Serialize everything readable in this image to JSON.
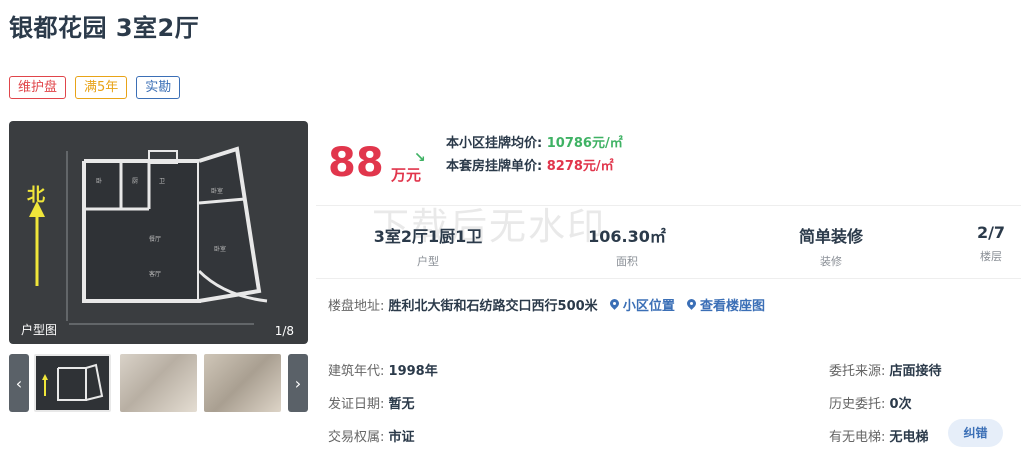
{
  "listing": {
    "title": "银都花园 3室2厅",
    "tags": [
      {
        "label": "维护盘",
        "color": "#e0454a"
      },
      {
        "label": "满5年",
        "color": "#e8a317"
      },
      {
        "label": "实勘",
        "color": "#3b6fb6"
      }
    ]
  },
  "gallery": {
    "main_label": "户型图",
    "counter": "1/8",
    "compass": "北",
    "prev_icon": "chevron-left-icon",
    "next_icon": "chevron-right-icon"
  },
  "price": {
    "total": "88",
    "unit": "万元",
    "trend_icon": "trend-down-icon",
    "community_avg_label": "本小区挂牌均价:",
    "community_avg_value": "10786元/㎡",
    "listing_unit_label": "本套房挂牌单价:",
    "listing_unit_value": "8278元/㎡"
  },
  "watermark": "下载后无水印",
  "stats": [
    {
      "value": "3室2厅1厨1卫",
      "label": "户型"
    },
    {
      "value": "106.30㎡",
      "label": "面积"
    },
    {
      "value": "简单装修",
      "label": "装修"
    },
    {
      "value": "2/7",
      "label": "楼层"
    }
  ],
  "address": {
    "label": "楼盘地址:",
    "value": "胜利北大街和石纺路交口西行500米",
    "link_community": "小区位置",
    "link_building": "查看楼座图"
  },
  "details_left": [
    {
      "label": "建筑年代:",
      "value": "1998年"
    },
    {
      "label": "发证日期:",
      "value": "暂无"
    },
    {
      "label": "交易权属:",
      "value": "市证"
    }
  ],
  "details_right": [
    {
      "label": "委托来源:",
      "value": "店面接待"
    },
    {
      "label": "历史委托:",
      "value": "0次"
    },
    {
      "label": "有无电梯:",
      "value": "无电梯"
    }
  ],
  "feedback_button": "纠错",
  "colors": {
    "price_red": "#e1364c",
    "avg_green": "#3fb264",
    "link_blue": "#3b6fb6"
  }
}
